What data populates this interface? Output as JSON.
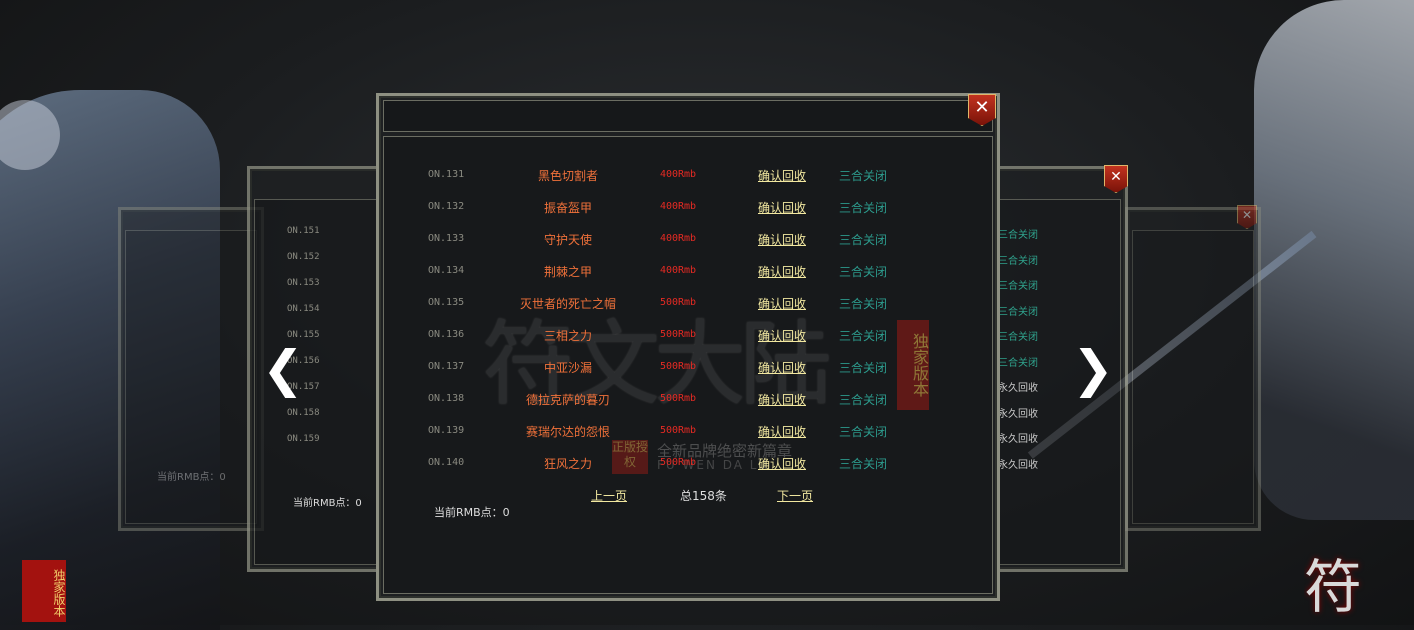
{
  "items": [
    {
      "no": "ON.131",
      "name": "黑色切割者",
      "price": "400Rmb",
      "confirm": "确认回收",
      "close": "三合关闭"
    },
    {
      "no": "ON.132",
      "name": "振奋盔甲",
      "price": "400Rmb",
      "confirm": "确认回收",
      "close": "三合关闭"
    },
    {
      "no": "ON.133",
      "name": "守护天使",
      "price": "400Rmb",
      "confirm": "确认回收",
      "close": "三合关闭"
    },
    {
      "no": "ON.134",
      "name": "荆棘之甲",
      "price": "400Rmb",
      "confirm": "确认回收",
      "close": "三合关闭"
    },
    {
      "no": "ON.135",
      "name": "灭世者的死亡之帽",
      "price": "500Rmb",
      "confirm": "确认回收",
      "close": "三合关闭"
    },
    {
      "no": "ON.136",
      "name": "三相之力",
      "price": "500Rmb",
      "confirm": "确认回收",
      "close": "三合关闭"
    },
    {
      "no": "ON.137",
      "name": "中亚沙漏",
      "price": "500Rmb",
      "confirm": "确认回收",
      "close": "三合关闭"
    },
    {
      "no": "ON.138",
      "name": "德拉克萨的暮刃",
      "price": "500Rmb",
      "confirm": "确认回收",
      "close": "三合关闭"
    },
    {
      "no": "ON.139",
      "name": "赛瑞尔达的怨恨",
      "price": "500Rmb",
      "confirm": "确认回收",
      "close": "三合关闭"
    },
    {
      "no": "ON.140",
      "name": "狂风之力",
      "price": "500Rmb",
      "confirm": "确认回收",
      "close": "三合关闭"
    }
  ],
  "pager": {
    "prev": "上一页",
    "total": "总158条",
    "next": "下一页"
  },
  "rmb_label": "当前RMB点：0",
  "left_panel": {
    "nos": [
      "ON.151",
      "ON.152",
      "ON.153",
      "ON.154",
      "ON.155",
      "ON.156",
      "ON.157",
      "ON.158",
      "ON.159"
    ],
    "rmb_label": "当前RMB点：0"
  },
  "right_panel": {
    "statuses": [
      "三合关闭",
      "三合关闭",
      "三合关闭",
      "三合关闭",
      "三合关闭",
      "三合关闭",
      "永久回收",
      "永久回收",
      "永久回收",
      "永久回收"
    ]
  },
  "far_left_rmb": "当前RMB点：0",
  "watermark": {
    "title": "符文大陆",
    "badge": "独家版本",
    "seal": "正版授权",
    "sub": "全新品牌绝密新篇章",
    "sub2": "FU WEN DA LU"
  },
  "corner_badge": "独家版本",
  "corner_brand": "符文",
  "icons": {
    "close": "close-icon",
    "prev": "chevron-left-icon",
    "next": "chevron-right-icon"
  },
  "colors": {
    "item_name": "#f0713a",
    "price": "#e52a23",
    "confirm": "#f2e8a0",
    "status": "#2c9a8c",
    "no": "#8a8a80"
  }
}
